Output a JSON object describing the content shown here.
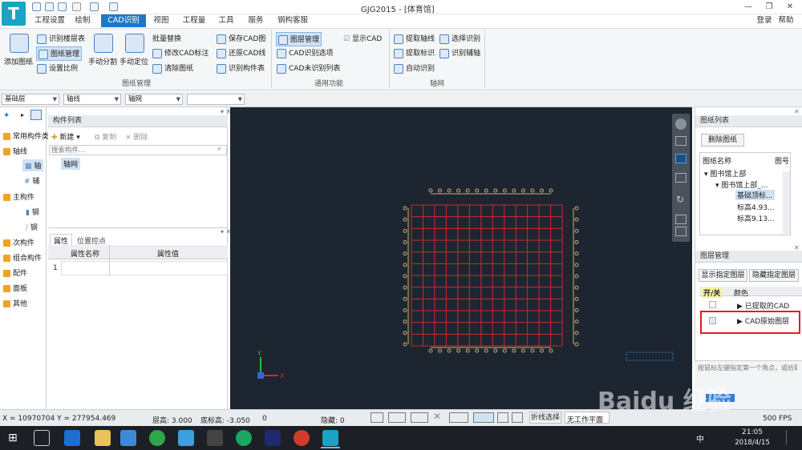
{
  "window": {
    "title": "GJG2015 - [体育馆]",
    "logo": "T"
  },
  "menus": [
    {
      "label": "工程设置"
    },
    {
      "label": "绘制"
    },
    {
      "label": "CAD识别"
    },
    {
      "label": "视图"
    },
    {
      "label": "工程量"
    },
    {
      "label": "工具"
    },
    {
      "label": "服务"
    },
    {
      "label": "钢构客服"
    }
  ],
  "account": {
    "login": "登录",
    "help": "帮助"
  },
  "ribbon": {
    "add_drawing": "添加图纸",
    "group1": {
      "title": "图纸管理",
      "items": [
        "识别楼层表",
        "图纸管理",
        "设置比例",
        "手动分割",
        "手动定位",
        "批量替换",
        "修改CAD标注",
        "清除图纸",
        "保存CAD图",
        "还原CAD线",
        "识别构件表"
      ]
    },
    "group2": {
      "title": "通用功能",
      "items": [
        "图层管理",
        "显示CAD",
        "CAD识别选项",
        "CAD未识别列表"
      ]
    },
    "group3": {
      "title": "轴网",
      "items": [
        "提取轴线",
        "选择识别",
        "提取标识",
        "识别辅轴",
        "自动识别"
      ]
    }
  },
  "selectors": [
    "基础层",
    "轴线",
    "轴网",
    ""
  ],
  "leftnav": {
    "items": [
      {
        "label": "常用构件类"
      },
      {
        "label": "轴线"
      },
      {
        "label": "轴"
      },
      {
        "label": "辅"
      },
      {
        "label": "主构件"
      },
      {
        "label": "钢"
      },
      {
        "label": "钢"
      },
      {
        "label": "次构件"
      },
      {
        "label": "组合构件"
      },
      {
        "label": "配件"
      },
      {
        "label": "面板"
      },
      {
        "label": "其他"
      }
    ]
  },
  "component_list": {
    "title": "构件列表",
    "new": "新建",
    "copy": "复制",
    "delete": "删除",
    "search_placeholder": "搜索构件...",
    "item": "轴网"
  },
  "props": {
    "tab1": "属性",
    "tab2": "位置控点",
    "col_name": "属性名称",
    "col_value": "属性值",
    "row1": "1"
  },
  "drawing_list": {
    "title": "图纸列表",
    "delete_btn": "删除图纸",
    "col_name": "图纸名称",
    "col2": "图号",
    "tree": [
      "图书馆上部",
      "图书馆上部_...",
      "基础顶标...",
      "标高4.93...",
      "标高9.13..."
    ]
  },
  "layer_panel": {
    "title": "图层管理",
    "show_btn": "显示指定图层",
    "hide_btn": "隐藏指定图层",
    "col_toggle": "开/关",
    "col_color": "颜色",
    "rows": [
      {
        "label": "已提取的CAD"
      },
      {
        "label": "CAD原始图层"
      }
    ]
  },
  "hint": "按鼠标左键指定第一个角点，或拾取构件图元",
  "status": {
    "coords": "X = 10970704 Y = 277954.469",
    "floor_height": "层高:   3.000",
    "bottom_elev": "底标高:  -3.050",
    "zero": "0",
    "hidden": "隐藏:   0",
    "polyline_sel": "折线选择",
    "workplane": "无工作平面",
    "fps": "500 FPS"
  },
  "taskbar": {
    "time": "21:05",
    "date": "2018/4/15",
    "ime": "中"
  },
  "watermark": "Baidu 经验",
  "colors": {
    "accent": "#1f77c9",
    "canvas": "#1d2530",
    "grid_red": "#d0282e",
    "grid_axis": "#c9b27a",
    "highlight_box": "#e02020"
  }
}
